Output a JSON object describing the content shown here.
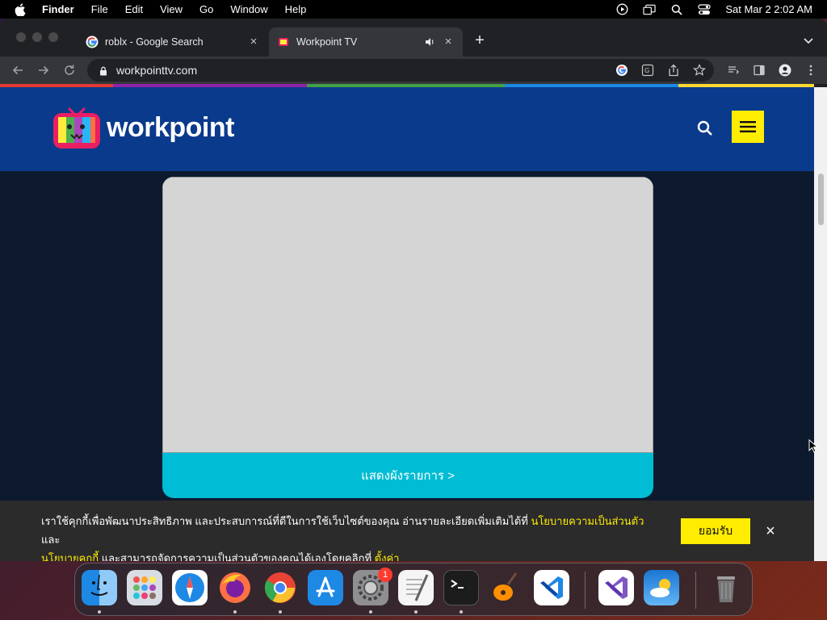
{
  "menubar": {
    "app": "Finder",
    "items": [
      "File",
      "Edit",
      "View",
      "Go",
      "Window",
      "Help"
    ],
    "clock": "Sat Mar 2  2:02 AM"
  },
  "tabs": [
    {
      "title": "roblx - Google Search",
      "favicon": "google-icon",
      "active": false
    },
    {
      "title": "Workpoint TV",
      "favicon": "workpoint-icon",
      "active": true,
      "audio": true
    }
  ],
  "toolbar": {
    "url": "workpointtv.com"
  },
  "site": {
    "logo_text": "workpoint",
    "brand_colors": {
      "header": "#0a3a8c",
      "accent": "#ffec00",
      "button": "#00bcd4"
    },
    "video_placeholder": "",
    "schedule_button": "แสดงผังรายการ >"
  },
  "cookie": {
    "text_1": "เราใช้คุกกี้เพื่อพัฒนาประสิทธิภาพ และประสบการณ์ที่ดีในการใช้เว็บไซต์ของคุณ อ่านรายละเอียดเพิ่มเติมได้ที่ ",
    "link_privacy": "นโยบายความเป็นส่วนตัว",
    "text_2": " และ ",
    "link_cookie": "นโยบายคุกกี้",
    "text_3": " และสามารถจัดการความเป็นส่วนตัวของคุณได้เองโดยคลิกที่ ",
    "link_settings": "ตั้งค่า",
    "accept": "ยอมรับ",
    "close": "×"
  },
  "dock": {
    "apps": [
      "finder",
      "launchpad",
      "safari",
      "firefox",
      "chrome",
      "app-store",
      "system-settings",
      "textedit",
      "terminal",
      "garageband",
      "vscode",
      "visual-studio",
      "weather",
      "trash"
    ],
    "settings_badge": "1"
  }
}
